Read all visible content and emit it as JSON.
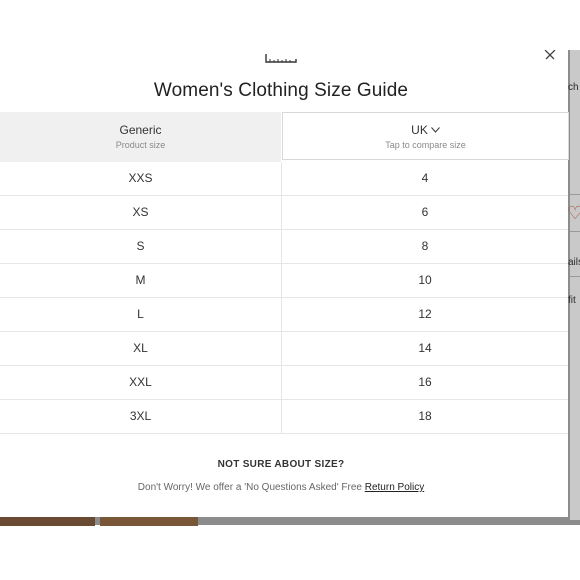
{
  "modal": {
    "title": "Women's Clothing Size Guide",
    "columns": [
      {
        "label": "Generic",
        "sublabel": "Product size"
      },
      {
        "label": "UK",
        "sublabel": "Tap to compare size"
      }
    ],
    "rows": [
      {
        "generic": "XXS",
        "uk": "4"
      },
      {
        "generic": "XS",
        "uk": "6"
      },
      {
        "generic": "S",
        "uk": "8"
      },
      {
        "generic": "M",
        "uk": "10"
      },
      {
        "generic": "L",
        "uk": "12"
      },
      {
        "generic": "XL",
        "uk": "14"
      },
      {
        "generic": "XXL",
        "uk": "16"
      },
      {
        "generic": "3XL",
        "uk": "18"
      }
    ],
    "footer": {
      "question": "NOT SURE ABOUT SIZE?",
      "note": "Don't Worry! We offer a 'No Questions Asked' Free ",
      "link": "Return Policy"
    },
    "icons": {
      "top": "measuring-tape-icon",
      "close": "close-icon",
      "dropdown": "chevron-down-icon"
    }
  },
  "background": {
    "fragments": [
      "ch",
      "ails",
      "fit"
    ],
    "accent_color": "#a0513c"
  }
}
